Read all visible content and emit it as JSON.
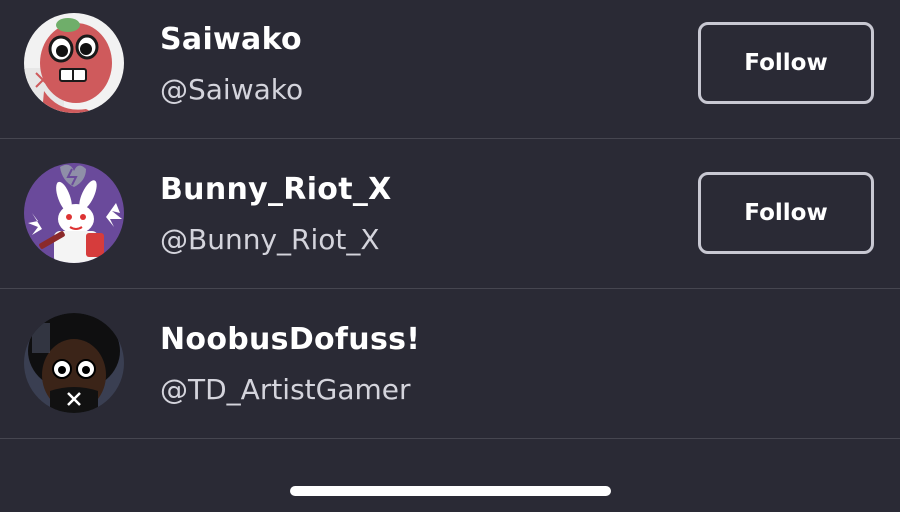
{
  "users": [
    {
      "name": "Saiwako",
      "handle": "@Saiwako",
      "follow_label": "Follow",
      "avatar_icon": "red-cartoon-character-avatar"
    },
    {
      "name": "Bunny_Riot_X",
      "handle": "@Bunny_Riot_X",
      "follow_label": "Follow",
      "avatar_icon": "white-rabbit-cartoon-avatar"
    },
    {
      "name": "NoobusDofuss!",
      "handle": "@TD_ArtistGamer",
      "avatar_icon": "masked-face-avatar"
    }
  ],
  "colors": {
    "background": "#2a2a35",
    "divider": "#464650",
    "button_border": "#c8c8d2",
    "text_primary": "#ffffff",
    "text_secondary": "#d4d4dc"
  }
}
